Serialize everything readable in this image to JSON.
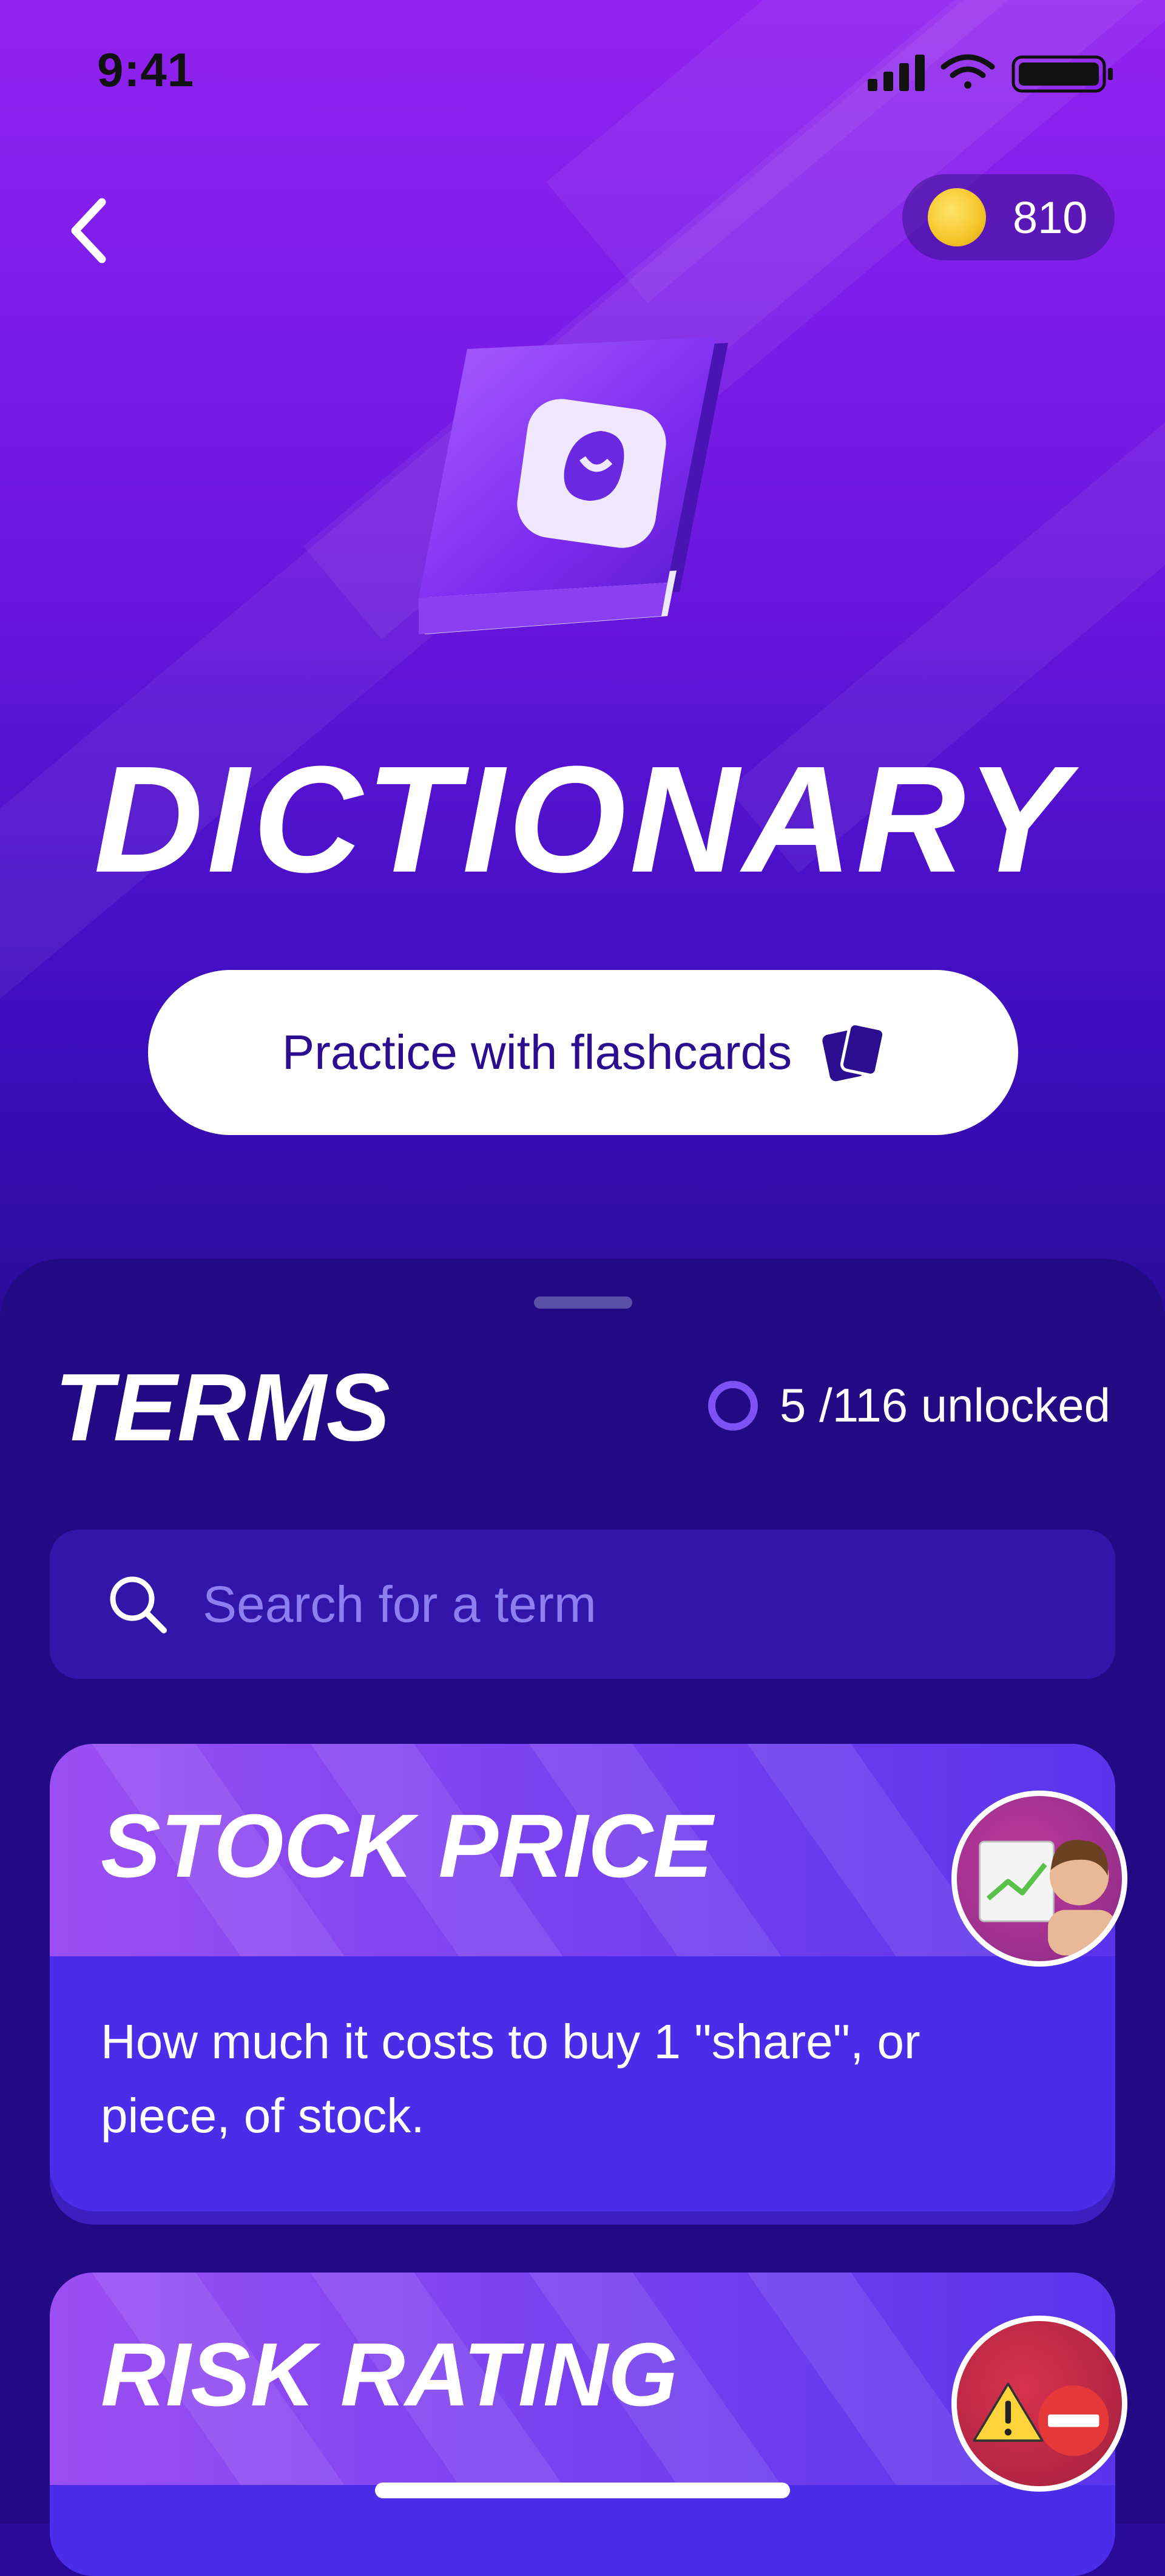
{
  "status_bar": {
    "time": "9:41"
  },
  "header": {
    "coins": "810"
  },
  "page": {
    "title": "DICTIONARY",
    "practice_button_label": "Practice with flashcards"
  },
  "terms": {
    "heading": "TERMS",
    "unlocked_label": "5 /116 unlocked",
    "search_placeholder": "Search for a term"
  },
  "cards": [
    {
      "title": "STOCK PRICE",
      "definition": "How much it costs to buy 1 \"share\", or piece, of stock.",
      "icon": "stock-chart-avatar-icon"
    },
    {
      "title": "RISK RATING",
      "definition": "",
      "icon": "warning-avatar-icon"
    }
  ],
  "colors": {
    "hero_top": "#9322f0",
    "sheet": "#220a85",
    "card": "#4b2ce8",
    "accent_ring": "#7c52f5",
    "button_text": "#2a0e8f"
  }
}
